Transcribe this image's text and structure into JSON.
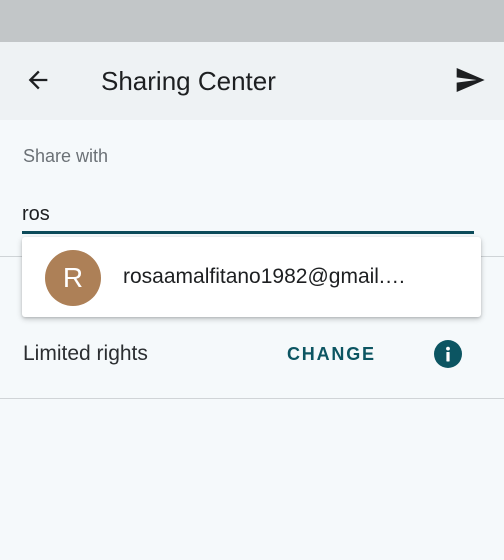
{
  "header": {
    "title": "Sharing Center",
    "back_icon": "arrow-left-icon",
    "send_icon": "send-icon"
  },
  "share": {
    "label": "Share with",
    "input_value": "ros"
  },
  "suggestion": {
    "avatar_letter": "R",
    "email": "rosaamalfitano1982@gmail.…"
  },
  "rights": {
    "label": "Limited rights",
    "change_label": "CHANGE",
    "info_icon": "info-icon"
  },
  "colors": {
    "accent": "#0c5562",
    "avatar": "#ad8057",
    "status_bar": "#c2c6c8"
  }
}
